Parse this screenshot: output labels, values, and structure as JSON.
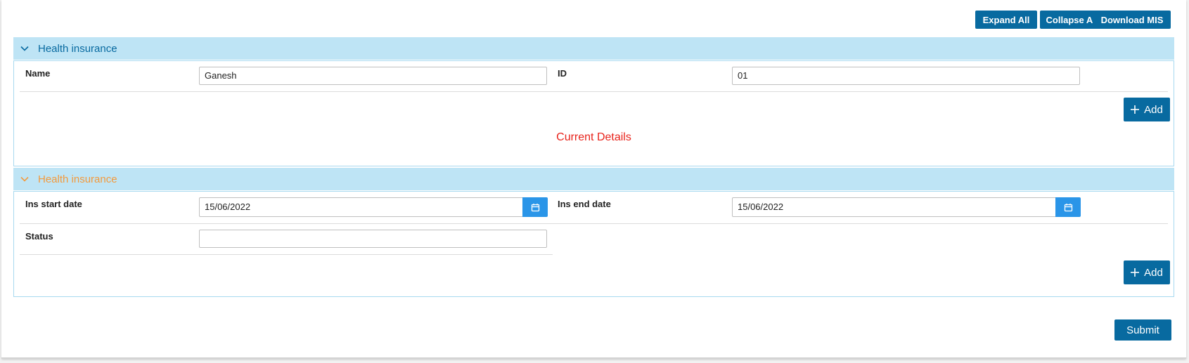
{
  "toolbar": {
    "expand_all": "Expand All",
    "collapse_all": "Collapse All",
    "download_mis": "Download MIS"
  },
  "section1": {
    "title": "Health insurance",
    "title_color": "#086aa0",
    "name_label": "Name",
    "name_value": "Ganesh",
    "id_label": "ID",
    "id_value": "01",
    "add_label": "Add",
    "current_details": "Current Details"
  },
  "section2": {
    "title": "Health insurance",
    "title_color": "#f39a3d",
    "start_label": "Ins start date",
    "start_value": "15/06/2022",
    "end_label": "Ins end date",
    "end_value": "15/06/2022",
    "status_label": "Status",
    "status_value": "",
    "add_label": "Add"
  },
  "submit_label": "Submit",
  "colors": {
    "primary_button": "#086aa0",
    "section_header": "#bee4f5",
    "calendar_button": "#2a95e8",
    "current_details_text": "#e8231b"
  }
}
